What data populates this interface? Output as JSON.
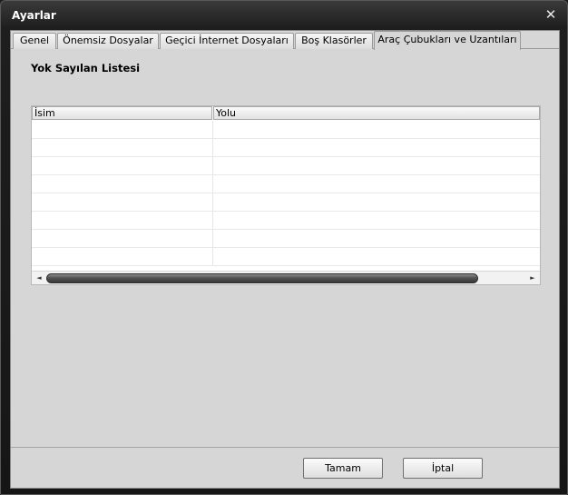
{
  "window": {
    "title": "Ayarlar",
    "close_glyph": "✕",
    "close_icon": "close-icon"
  },
  "tabs": [
    {
      "label": "Genel",
      "active": false
    },
    {
      "label": "Önemsiz Dosyalar",
      "active": false
    },
    {
      "label": "Geçici İnternet Dosyaları",
      "active": false
    },
    {
      "label": "Boş Klasörler",
      "active": false
    },
    {
      "label": "Araç Çubukları ve Uzantıları",
      "active": true
    }
  ],
  "section": {
    "title": "Yok Sayılan Listesi"
  },
  "table": {
    "columns": [
      "İsim",
      "Yolu"
    ],
    "rows": [
      [
        "",
        ""
      ],
      [
        "",
        ""
      ],
      [
        "",
        ""
      ],
      [
        "",
        ""
      ],
      [
        "",
        ""
      ],
      [
        "",
        ""
      ],
      [
        "",
        ""
      ],
      [
        "",
        ""
      ]
    ],
    "scroll_left_glyph": "◄",
    "scroll_right_glyph": "►"
  },
  "buttons": {
    "ok": "Tamam",
    "cancel": "İptal"
  }
}
